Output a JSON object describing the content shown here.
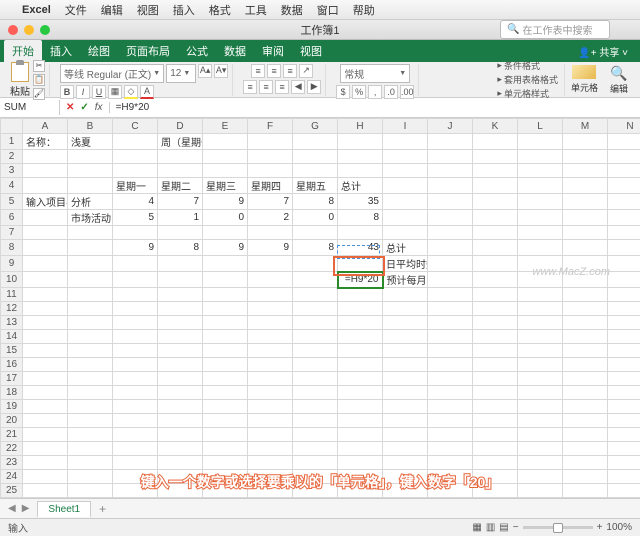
{
  "mac_menu": {
    "app": "Excel",
    "items": [
      "文件",
      "编辑",
      "视图",
      "插入",
      "格式",
      "工具",
      "数据",
      "窗口",
      "帮助"
    ]
  },
  "window": {
    "title": "工作簿1",
    "search_placeholder": "在工作表中搜索"
  },
  "ribbon": {
    "tabs": [
      "开始",
      "插入",
      "绘图",
      "页面布局",
      "公式",
      "数据",
      "审阅",
      "视图"
    ],
    "share": "共享",
    "font": "等线 Regular (正文)",
    "size": "12",
    "num_format": "常规",
    "cond": "条件格式",
    "tbl": "套用表格格式",
    "cell_style_btn": "单元格样式",
    "cell_label": "单元格",
    "edit": "编辑",
    "paste": "粘贴"
  },
  "formula": {
    "name_box": "SUM",
    "value": "=H9*20"
  },
  "cols": [
    "A",
    "B",
    "C",
    "D",
    "E",
    "F",
    "G",
    "H",
    "I",
    "J",
    "K",
    "L",
    "M",
    "N"
  ],
  "rows": 13,
  "cells": {
    "r1": {
      "A": "名称：",
      "B": "浅夏",
      "D": "周（星期一）"
    },
    "r4": {
      "C": "星期一",
      "D": "星期二",
      "E": "星期三",
      "F": "星期四",
      "G": "星期五",
      "H": "总计"
    },
    "r5": {
      "A": "输入项目名称：",
      "B": "分析",
      "C": "4",
      "D": "7",
      "E": "9",
      "F": "7",
      "G": "8",
      "H": "35"
    },
    "r6": {
      "B": "市场活动",
      "C": "5",
      "D": "1",
      "E": "0",
      "F": "2",
      "G": "0",
      "H": "8"
    },
    "r8": {
      "C": "9",
      "D": "8",
      "E": "9",
      "F": "9",
      "G": "8",
      "H": "43",
      "I": "总计"
    },
    "r9": {
      "I": "日平均时数"
    },
    "r10": {
      "H": "=H9*20",
      "I": "预计每月小时数"
    }
  },
  "sheet": {
    "name": "Sheet1"
  },
  "status": {
    "mode": "输入",
    "zoom": "100%"
  },
  "annotation": "键入一个数字或选择要乘以的「单元格」，键入数字「20」",
  "watermark": "www.MacZ.com"
}
